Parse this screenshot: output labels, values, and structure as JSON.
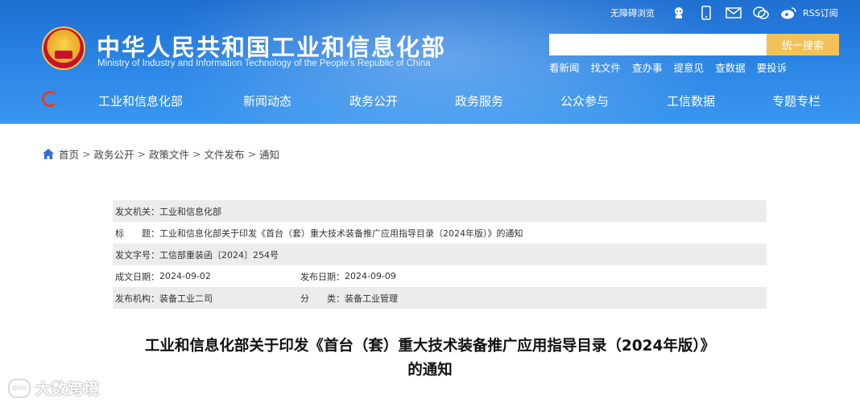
{
  "header": {
    "title_cn": "中华人民共和国工业和信息化部",
    "title_en": "Ministry of Industry and Information Technology of the People's Republic of China"
  },
  "util": {
    "accessibility": "无障碍浏览",
    "rss": "RSS订阅",
    "icons": [
      "robot-icon",
      "mobile-icon",
      "mail-icon",
      "wechat-icon",
      "weibo-icon",
      "rss-icon"
    ]
  },
  "search": {
    "placeholder": "",
    "button": "统一搜索"
  },
  "quick_links": [
    "看新闻",
    "找文件",
    "查办事",
    "提意见",
    "查数据",
    "要投诉"
  ],
  "nav": [
    "工业和信息化部",
    "新闻动态",
    "政务公开",
    "政务服务",
    "公众参与",
    "工信数据",
    "专题专栏"
  ],
  "breadcrumb": [
    "首页",
    "政务公开",
    "政策文件",
    "文件发布",
    "通知"
  ],
  "info": {
    "issuer_label": "发文机关：",
    "issuer": "工业和信息化部",
    "title_label": "标　　题：",
    "title": "工业和信息化部关于印发《首台（套）重大技术装备推广应用指导目录（2024年版）》的通知",
    "docno_label": "发文字号：",
    "docno": "工信部重装函〔2024〕254号",
    "created_label": "成文日期：",
    "created": "2024-09-02",
    "published_label": "发布日期：",
    "published": "2024-09-09",
    "org_label": "发布机构：",
    "org": "装备工业二司",
    "category_label": "分　　类：",
    "category": "装备工业管理"
  },
  "article": {
    "title_line1": "工业和信息化部关于印发《首台（套）重大技术装备推广应用指导目录（2024年版）》",
    "title_line2": "的通知"
  },
  "watermark": {
    "text": "大数跨境"
  },
  "colors": {
    "header_blue": "#2c86e6",
    "search_button": "#f2c157",
    "row_shade": "#ececec"
  }
}
